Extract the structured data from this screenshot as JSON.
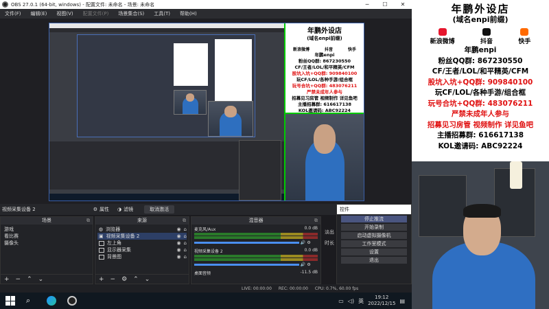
{
  "window": {
    "title": "OBS 27.0.1 (64-bit, windows) - 配置文件: 未命名 - 场景: 未命名"
  },
  "menu": [
    "文件(F)",
    "编辑(E)",
    "视图(V)",
    "配置文件(P)",
    "场景集合(S)",
    "工具(T)",
    "帮助(H)"
  ],
  "source_toolbar": {
    "source_name": "视频采集设备 2",
    "properties": "属性",
    "filters": "滤镜",
    "deactivate": "取消激活"
  },
  "scenes": {
    "title": "场景",
    "items": [
      "游戏",
      "看比赛",
      "摄像头"
    ]
  },
  "sources": {
    "title": "来源",
    "items": [
      {
        "name": "浏览器",
        "icon": "globe-icon"
      },
      {
        "name": "视频采集设备 2",
        "icon": "camera-icon"
      },
      {
        "name": "左上角",
        "icon": "image-icon"
      },
      {
        "name": "显示器采集",
        "icon": "monitor-icon"
      },
      {
        "name": "背景图",
        "icon": "image-icon"
      }
    ]
  },
  "mixer": {
    "title": "混音器",
    "channels": [
      {
        "name": "麦克风/Aux",
        "value": "0.0 dB"
      },
      {
        "name": "视频采集设备 2",
        "value": "0.0 dB"
      },
      {
        "name": "桌面音频",
        "value": "-11.5 dB"
      }
    ]
  },
  "transition": {
    "label1": "淡出",
    "label2": "时长"
  },
  "controls": {
    "title": "控件",
    "buttons": [
      "停止推流",
      "开始录制",
      "启动虚拟摄像机",
      "工作室模式",
      "设置",
      "退出"
    ]
  },
  "status": {
    "live": "LIVE: 00:00:00",
    "rec": "REC: 00:00:00",
    "cpu": "CPU: 0.7%, 60.00 fps"
  },
  "taskbar": {
    "time": "19:12",
    "date": "2022/12/15",
    "ime": "英"
  },
  "poster": {
    "title": "年鹏外设店",
    "subtitle": "(域名enpi前缀)",
    "socials": [
      "新浪微博",
      "抖音",
      "快手"
    ],
    "brand": "年鹏enpi",
    "lines": [
      {
        "text": "粉丝QQ群: 867230550",
        "color": "#000000"
      },
      {
        "text": "CF/王者/LOL/和平精英/CFM",
        "color": "#000000"
      },
      {
        "text": "股坑入坑+QQ群: 909840100",
        "color": "#e01010"
      },
      {
        "text": "玩CF/LOL/各种手游/组合框",
        "color": "#000000"
      },
      {
        "text": "玩号合坑+QQ群: 483076211",
        "color": "#e01010"
      },
      {
        "text": "严禁未成年人参与",
        "color": "#e01010"
      },
      {
        "text": "招募见习房管 视频制作 详见鱼吧",
        "color": "#e01010"
      },
      {
        "text": "主播招募群: 616617138",
        "color": "#000000"
      },
      {
        "text": "KOL邀请码: ABC92224",
        "color": "#000000"
      }
    ]
  }
}
